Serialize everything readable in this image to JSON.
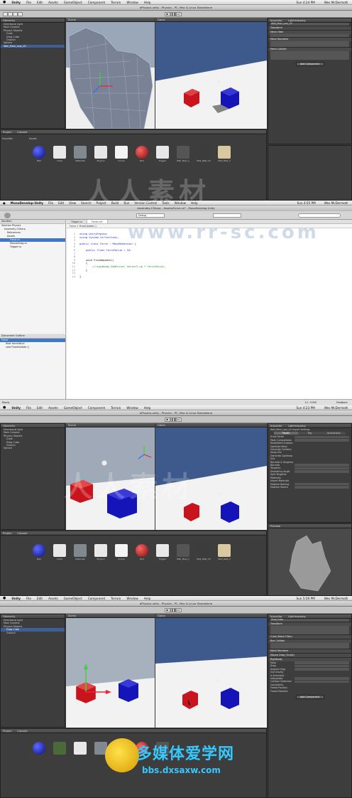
{
  "menubar": {
    "apple": "",
    "app": "Unity",
    "items": [
      "File",
      "Edit",
      "Assets",
      "GameObject",
      "Component",
      "Terrain",
      "Window",
      "Help"
    ]
  },
  "frame1": {
    "clock": "Sun 4:24 PM",
    "user": "Wes McDermott",
    "title": "aPhysics.unity - Physics - PC, Mac & Linux Standalone",
    "hierarchy_title": "Hierarchy",
    "hierarchy": [
      "Directional light",
      "Main Camera",
      "Physics Objects",
      "Cube",
      "Drag Cube",
      "Ground",
      "Sphere",
      "Wall_Main_Low_UV"
    ],
    "scene_tab": "Scene",
    "game_tab": "Game",
    "inspector_tab": "Inspector",
    "lightmap_tab": "Lightmapping",
    "selected_name": "Wall_Main_Low_UV",
    "comps": [
      "Transform",
      "Mesh Filter",
      "Mesh Renderer",
      "Mesh Collider"
    ],
    "add_component": "Add Component",
    "project_tab": "Project",
    "console_tab": "Console",
    "favorites": "Favorites",
    "assets_root": "Assets",
    "assets": [
      "Ball",
      "Cube",
      "Materials",
      "Physics",
      "Scene",
      "Red",
      "Trigger",
      "Wall_Main_L",
      "Wall_Wall_UV",
      "Wall_Wall_2"
    ]
  },
  "frame2": {
    "app": "MonoDevelop-Unity",
    "menu": [
      "File",
      "Edit",
      "View",
      "Search",
      "Project",
      "Build",
      "Run",
      "Version Control",
      "Tools",
      "Window",
      "Help"
    ],
    "clock": "Sun 4:55 PM",
    "user": "Wes McDermott",
    "title": "Assembly-CSharp - Assets/Force.cs* - MonoDevelop-Unity",
    "config": "Debug",
    "solution_title": "Solution",
    "tree": [
      "Solution Physics",
      "Assembly-CSharp",
      "References",
      "Assets",
      "Force.cs",
      "MouseDrag.cs",
      "Trigger.cs"
    ],
    "outline_title": "Document Outline",
    "outline": [
      "Force",
      "float forceValue",
      "void FixedUpdate ()"
    ],
    "tabs": [
      "Trigger.cs",
      "Force.cs*"
    ],
    "path": "Force > FixedUpdate ()",
    "code": [
      "using UnityEngine;",
      "using System.Collections;",
      "",
      "public class Force : MonoBehaviour {",
      "",
      "    public float forceValue = 10;",
      "",
      "",
      "    void FixedUpdate()",
      "    {",
      "        //rigidbody.AddForce( Vector3.up * forceValue);",
      "    }",
      "",
      "}"
    ],
    "status_left": "Ready",
    "status_right": "12 : 9   INS",
    "feedback": "Feedback"
  },
  "frame3": {
    "clock": "Sun 4:23 PM",
    "user": "Wes McDermott",
    "hierarchy": [
      "Directional light",
      "Main Camera",
      "Physics Objects",
      "Cube",
      "Drag Cube",
      "Ground",
      "Sphere"
    ],
    "inspector_title": "Wall_Main_Low_UV Import Settings",
    "tabs": [
      "Model",
      "Rig",
      "Animations"
    ],
    "props": [
      "Scale Factor",
      "Mesh Compression",
      "Read/Write Enabled",
      "Optimize Mesh",
      "Generate Colliders",
      "Swap UVs",
      "Generate Lightmap UVs",
      "Normals & Tangents",
      "Normals",
      "Tangents",
      "Smoothing Angle",
      "Split Tangents",
      "Materials",
      "Import Materials",
      "Material Naming",
      "Material Search"
    ],
    "preview": "Preview"
  },
  "frame4": {
    "clock": "Sun 5:59 PM",
    "user": "Wes McDermott",
    "hierarchy": [
      "Directional light",
      "Main Camera",
      "Physics Objects",
      "Drag Cube",
      "Ground"
    ],
    "selected": "Drag Cube",
    "comps": [
      "Transform",
      "Cube (Mesh Filter)",
      "Box Collider",
      "Mesh Renderer",
      "Mouse Drag (Script)",
      "Rigidbody"
    ],
    "rb_props": [
      "Mass",
      "Drag",
      "Angular Drag",
      "Use Gravity",
      "Is Kinematic",
      "Interpolate",
      "Collision Detection",
      "Constraints",
      "Freeze Position",
      "Freeze Rotation"
    ],
    "add_component": "Add Component"
  },
  "watermark": {
    "cn": "人人素材",
    "url": "www.rr-sc.com",
    "site": "bbs.dxsaxw.com",
    "logo": "多媒体爱学网"
  },
  "colors": {
    "red": "#c8141c",
    "blue": "#1414b8",
    "sky": "#3e5a8c",
    "selection": "#3e5f96"
  }
}
